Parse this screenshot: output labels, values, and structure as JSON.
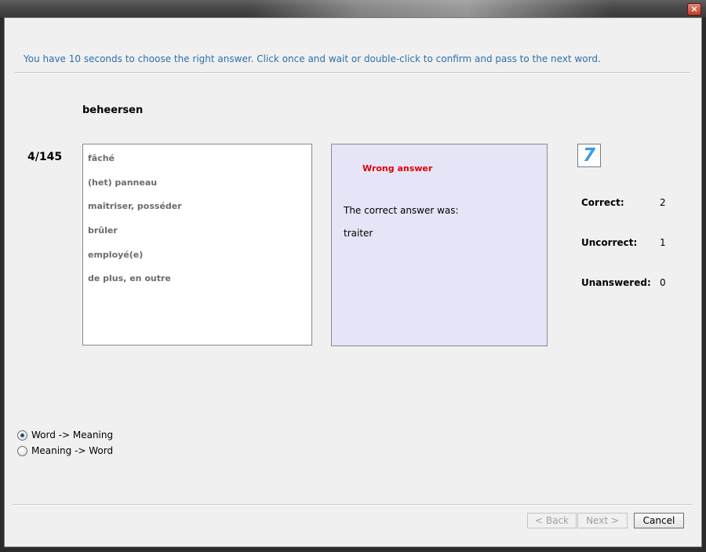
{
  "window": {
    "close_symbol": "×"
  },
  "instruction": "You have 10 seconds to choose the right answer.  Click once and wait or double-click to confirm and pass to the next word.",
  "question": {
    "word": "beheersen",
    "counter": "4/145"
  },
  "choices": [
    {
      "label": "fâché"
    },
    {
      "label": "(het) panneau"
    },
    {
      "label": "maîtriser, posséder"
    },
    {
      "label": "brûler"
    },
    {
      "label": "employé(e)"
    },
    {
      "label": "de plus, en outre"
    }
  ],
  "feedback": {
    "status": "Wrong answer",
    "correct_label": "The correct answer was:",
    "correct_value": "traiter"
  },
  "timer": {
    "seconds": "7",
    "color": "#3b9ae8"
  },
  "stats": {
    "correct_label": "Correct:",
    "correct_value": "2",
    "uncorrect_label": "Uncorrect:",
    "uncorrect_value": "1",
    "unanswered_label": "Unanswered:",
    "unanswered_value": "0"
  },
  "mode": {
    "options": [
      {
        "label": "Word -> Meaning",
        "checked": true
      },
      {
        "label": "Meaning -> Word",
        "checked": false
      }
    ]
  },
  "buttons": {
    "back": "< Back",
    "next": "Next >",
    "cancel": "Cancel"
  },
  "colors": {
    "instruction": "#2f6fa8",
    "wrong": "#e00000",
    "feedback_bg": "#e5e5f7"
  }
}
